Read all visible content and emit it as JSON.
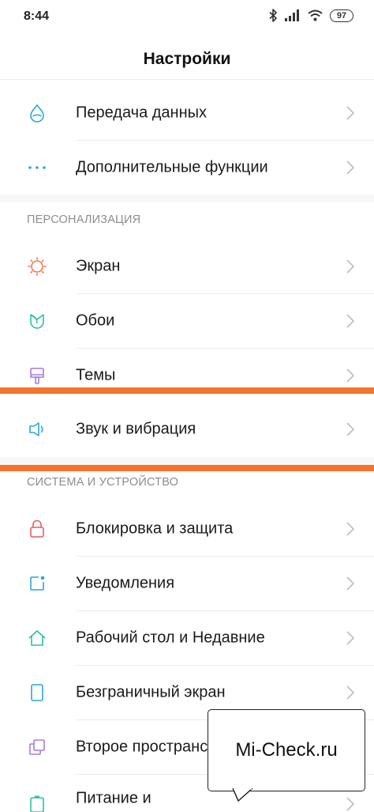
{
  "status_bar": {
    "time": "8:44",
    "battery": "97",
    "icons": [
      "bluetooth-icon",
      "signal-icon",
      "wifi-icon",
      "battery-icon"
    ]
  },
  "header": {
    "title": "Настройки"
  },
  "group_top": {
    "items": [
      {
        "label": "Передача данных",
        "icon": "data-usage-icon"
      },
      {
        "label": "Дополнительные функции",
        "icon": "more-dots-icon"
      }
    ]
  },
  "personalization": {
    "header": "ПЕРСОНАЛИЗАЦИЯ",
    "items": [
      {
        "label": "Экран",
        "icon": "display-icon"
      },
      {
        "label": "Обои",
        "icon": "wallpaper-icon"
      },
      {
        "label": "Темы",
        "icon": "themes-icon"
      },
      {
        "label": "Звук и вибрация",
        "icon": "sound-icon"
      }
    ]
  },
  "system": {
    "header": "СИСТЕМА И УСТРОЙСТВО",
    "items": [
      {
        "label": "Блокировка и защита",
        "icon": "lock-icon"
      },
      {
        "label": "Уведомления",
        "icon": "notifications-icon"
      },
      {
        "label": "Рабочий стол и Недавние",
        "icon": "home-icon"
      },
      {
        "label": "Безграничный экран",
        "icon": "fullscreen-icon"
      },
      {
        "label": "Второе пространство",
        "icon": "second-space-icon"
      },
      {
        "label": "Питание и",
        "icon": "battery-power-icon"
      }
    ]
  },
  "colors": {
    "highlight": "#f5732a",
    "icon_blue": "#2aa7d9",
    "icon_orange": "#f07a4a",
    "icon_teal": "#2bbfa6",
    "icon_purple": "#a879d6",
    "icon_red": "#ec5a63"
  },
  "watermark": {
    "text": "Mi-Check.ru"
  }
}
